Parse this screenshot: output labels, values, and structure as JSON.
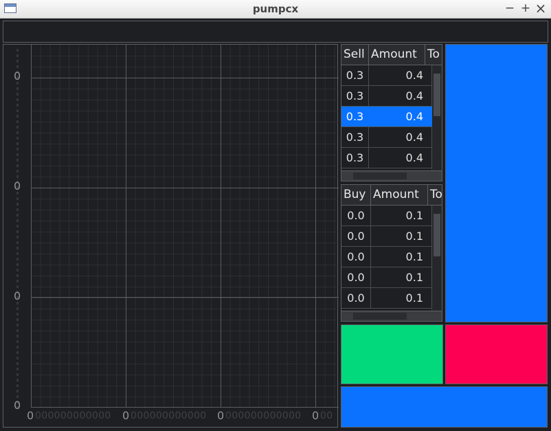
{
  "window": {
    "title": "pumpcx",
    "minimize": "−",
    "maximize": "+",
    "close": "×"
  },
  "colors": {
    "buy": "#02d97d",
    "sell": "#fd0054",
    "accent": "#0a72ff",
    "background": "#1d1f22"
  },
  "chart": {
    "y_labels": [
      "0",
      "0",
      "0",
      "0"
    ],
    "x_labels": [
      "0",
      "0",
      "0",
      "0"
    ],
    "x_minor": "000000000000",
    "x_minor_end": "00"
  },
  "sell_book": {
    "headers": [
      "Sell",
      "Amount",
      "To"
    ],
    "rows": [
      {
        "price": "0.3",
        "amount": "0.4"
      },
      {
        "price": "0.3",
        "amount": "0.4"
      },
      {
        "price": "0.3",
        "amount": "0.4",
        "selected": true
      },
      {
        "price": "0.3",
        "amount": "0.4"
      },
      {
        "price": "0.3",
        "amount": "0.4"
      }
    ]
  },
  "buy_book": {
    "headers": [
      "Buy",
      "Amount",
      "To"
    ],
    "rows": [
      {
        "price": "0.0",
        "amount": "0.1"
      },
      {
        "price": "0.0",
        "amount": "0.1"
      },
      {
        "price": "0.0",
        "amount": "0.1"
      },
      {
        "price": "0.0",
        "amount": "0.1"
      },
      {
        "price": "0.0",
        "amount": "0.1"
      }
    ]
  }
}
